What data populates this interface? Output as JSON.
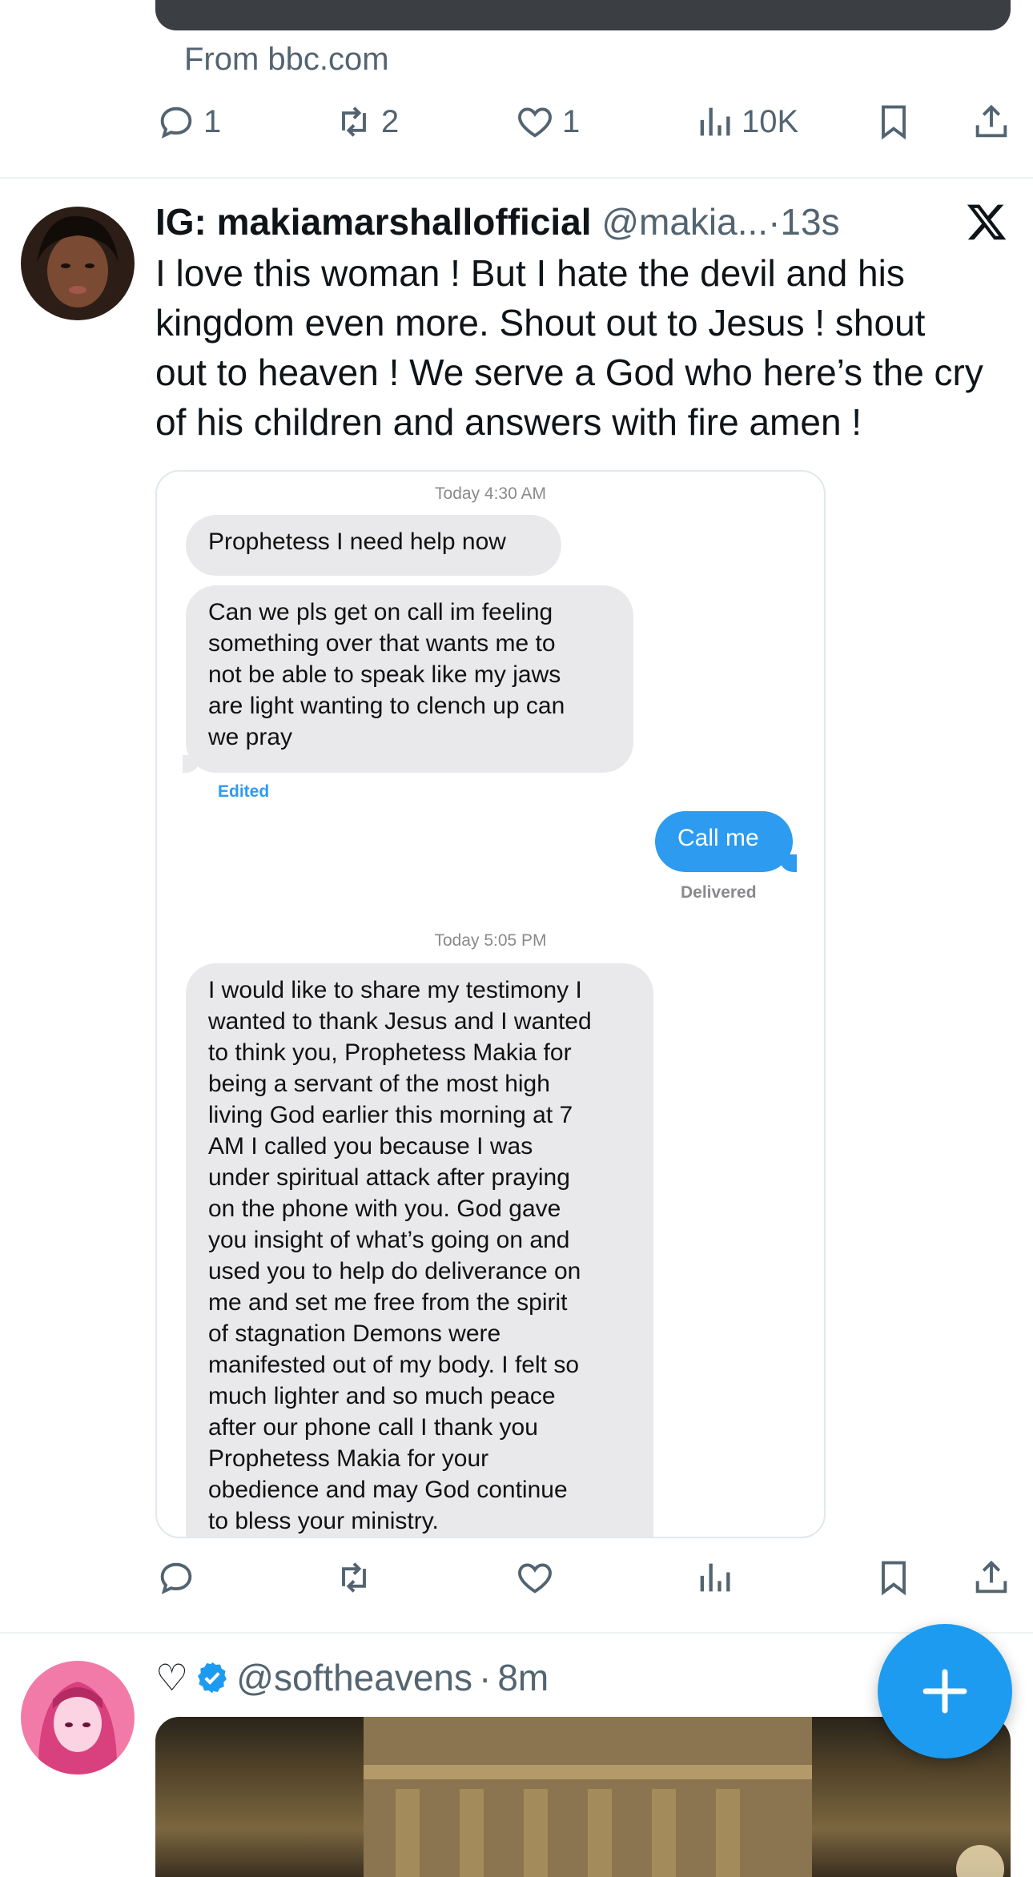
{
  "previous_tweet": {
    "source": "From bbc.com",
    "stats": {
      "replies": "1",
      "retweets": "2",
      "likes": "1",
      "views": "10K"
    }
  },
  "tweet": {
    "display_name": "IG: makiamarshallofficial",
    "handle": "@makia...",
    "separator": "·",
    "time": "13s",
    "text_lines": [
      "I love this woman ! But I hate the devil and his",
      "kingdom even more. Shout out to Jesus ! shout",
      "out to heaven ! We serve a God who here’s the cry",
      "of his children and answers with fire amen !"
    ],
    "screenshot": {
      "timestamp_1": "Today 4:30 AM",
      "msg_1": "Prophetess I need help now",
      "msg_2_lines": [
        "Can we pls get on call im feeling",
        "something over that wants me to",
        "not be able to speak like my jaws",
        "are light wanting to clench up can",
        "we pray"
      ],
      "edited_label": "Edited",
      "reply": "Call me",
      "delivered_label": "Delivered",
      "timestamp_2": "Today 5:05 PM",
      "msg_3_lines": [
        "I would like to share my testimony I",
        "wanted to thank Jesus and I wanted",
        "to think you, Prophetess Makia for",
        "being a servant of the most high",
        "living God earlier this morning at 7",
        "AM I called you because I was",
        "under spiritual attack after praying",
        "on the phone with you. God gave",
        "you insight of what’s going on and",
        "used you to help do deliverance on",
        "me and set me free from the spirit",
        "of stagnation Demons were",
        "manifested out of my body. I felt so",
        "much lighter and so much peace",
        "after our phone call I thank you",
        "Prophetess Makia for your",
        "obedience and may God continue",
        "to bless your ministry."
      ]
    }
  },
  "next_tweet": {
    "prefix": "♡",
    "handle": "@softheavens",
    "separator": "·",
    "time": "8m"
  },
  "colors": {
    "accent": "#1d9bf0",
    "muted": "#536471",
    "imessage_blue": "#2c9bf0",
    "bubble_gray": "#e9e9eb"
  },
  "icons": [
    "reply-icon",
    "retweet-icon",
    "like-icon",
    "views-icon",
    "bookmark-icon",
    "share-icon",
    "x-logo-icon",
    "verified-icon",
    "compose-plus-icon"
  ]
}
